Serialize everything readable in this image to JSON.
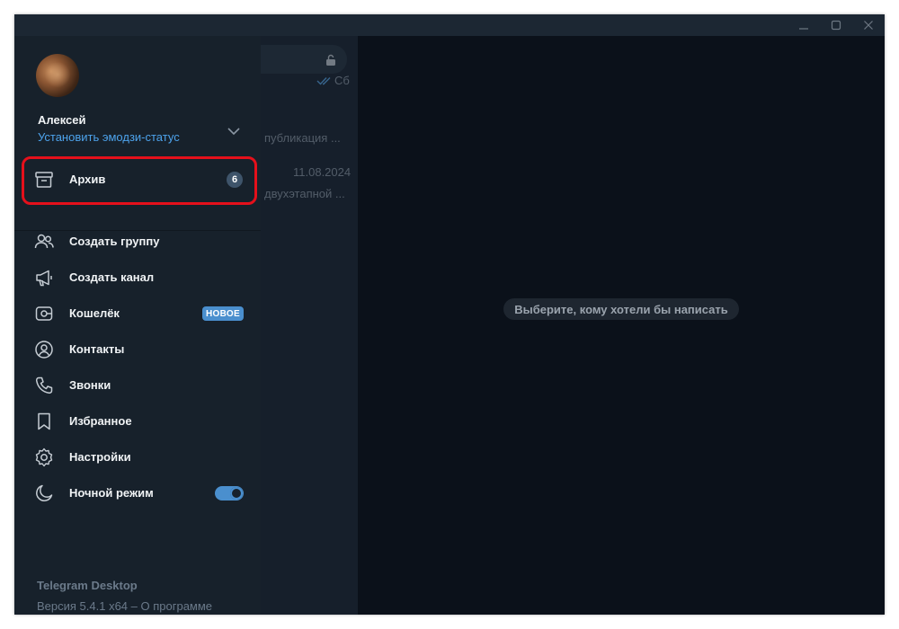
{
  "window": {
    "controls": [
      "minimize-icon",
      "maximize-icon",
      "close-icon"
    ]
  },
  "background": {
    "chat_list": [
      {
        "time": "Сб",
        "preview": "публикация ...",
        "read_icon": "double-check-icon"
      },
      {
        "time": "11.08.2024",
        "preview": "двухэтапной ..."
      }
    ],
    "empty_chat_hint": "Выберите, кому хотели бы написать"
  },
  "sidemenu": {
    "user_name": "Алексей",
    "emoji_status": "Установить эмодзи-статус",
    "items": [
      {
        "id": "archive",
        "label": "Архив",
        "icon": "archive-icon",
        "badge": "6"
      },
      {
        "id": "new-group",
        "label": "Создать группу",
        "icon": "group-icon"
      },
      {
        "id": "new-channel",
        "label": "Создать канал",
        "icon": "megaphone-icon"
      },
      {
        "id": "wallet",
        "label": "Кошелёк",
        "icon": "wallet-icon",
        "badge": "НОВОЕ"
      },
      {
        "id": "contacts",
        "label": "Контакты",
        "icon": "contact-icon"
      },
      {
        "id": "calls",
        "label": "Звонки",
        "icon": "phone-icon"
      },
      {
        "id": "saved",
        "label": "Избранное",
        "icon": "bookmark-icon"
      },
      {
        "id": "settings",
        "label": "Настройки",
        "icon": "gear-icon"
      },
      {
        "id": "night-mode",
        "label": "Ночной режим",
        "icon": "moon-icon",
        "toggle": true
      }
    ],
    "footer": {
      "app_name": "Telegram Desktop",
      "version": "Версия 5.4.1 x64",
      "separator": " – ",
      "about": "О программе"
    }
  },
  "colors": {
    "accent": "#4da3ec",
    "highlight": "#e5101b",
    "menu_bg": "#17212b"
  }
}
